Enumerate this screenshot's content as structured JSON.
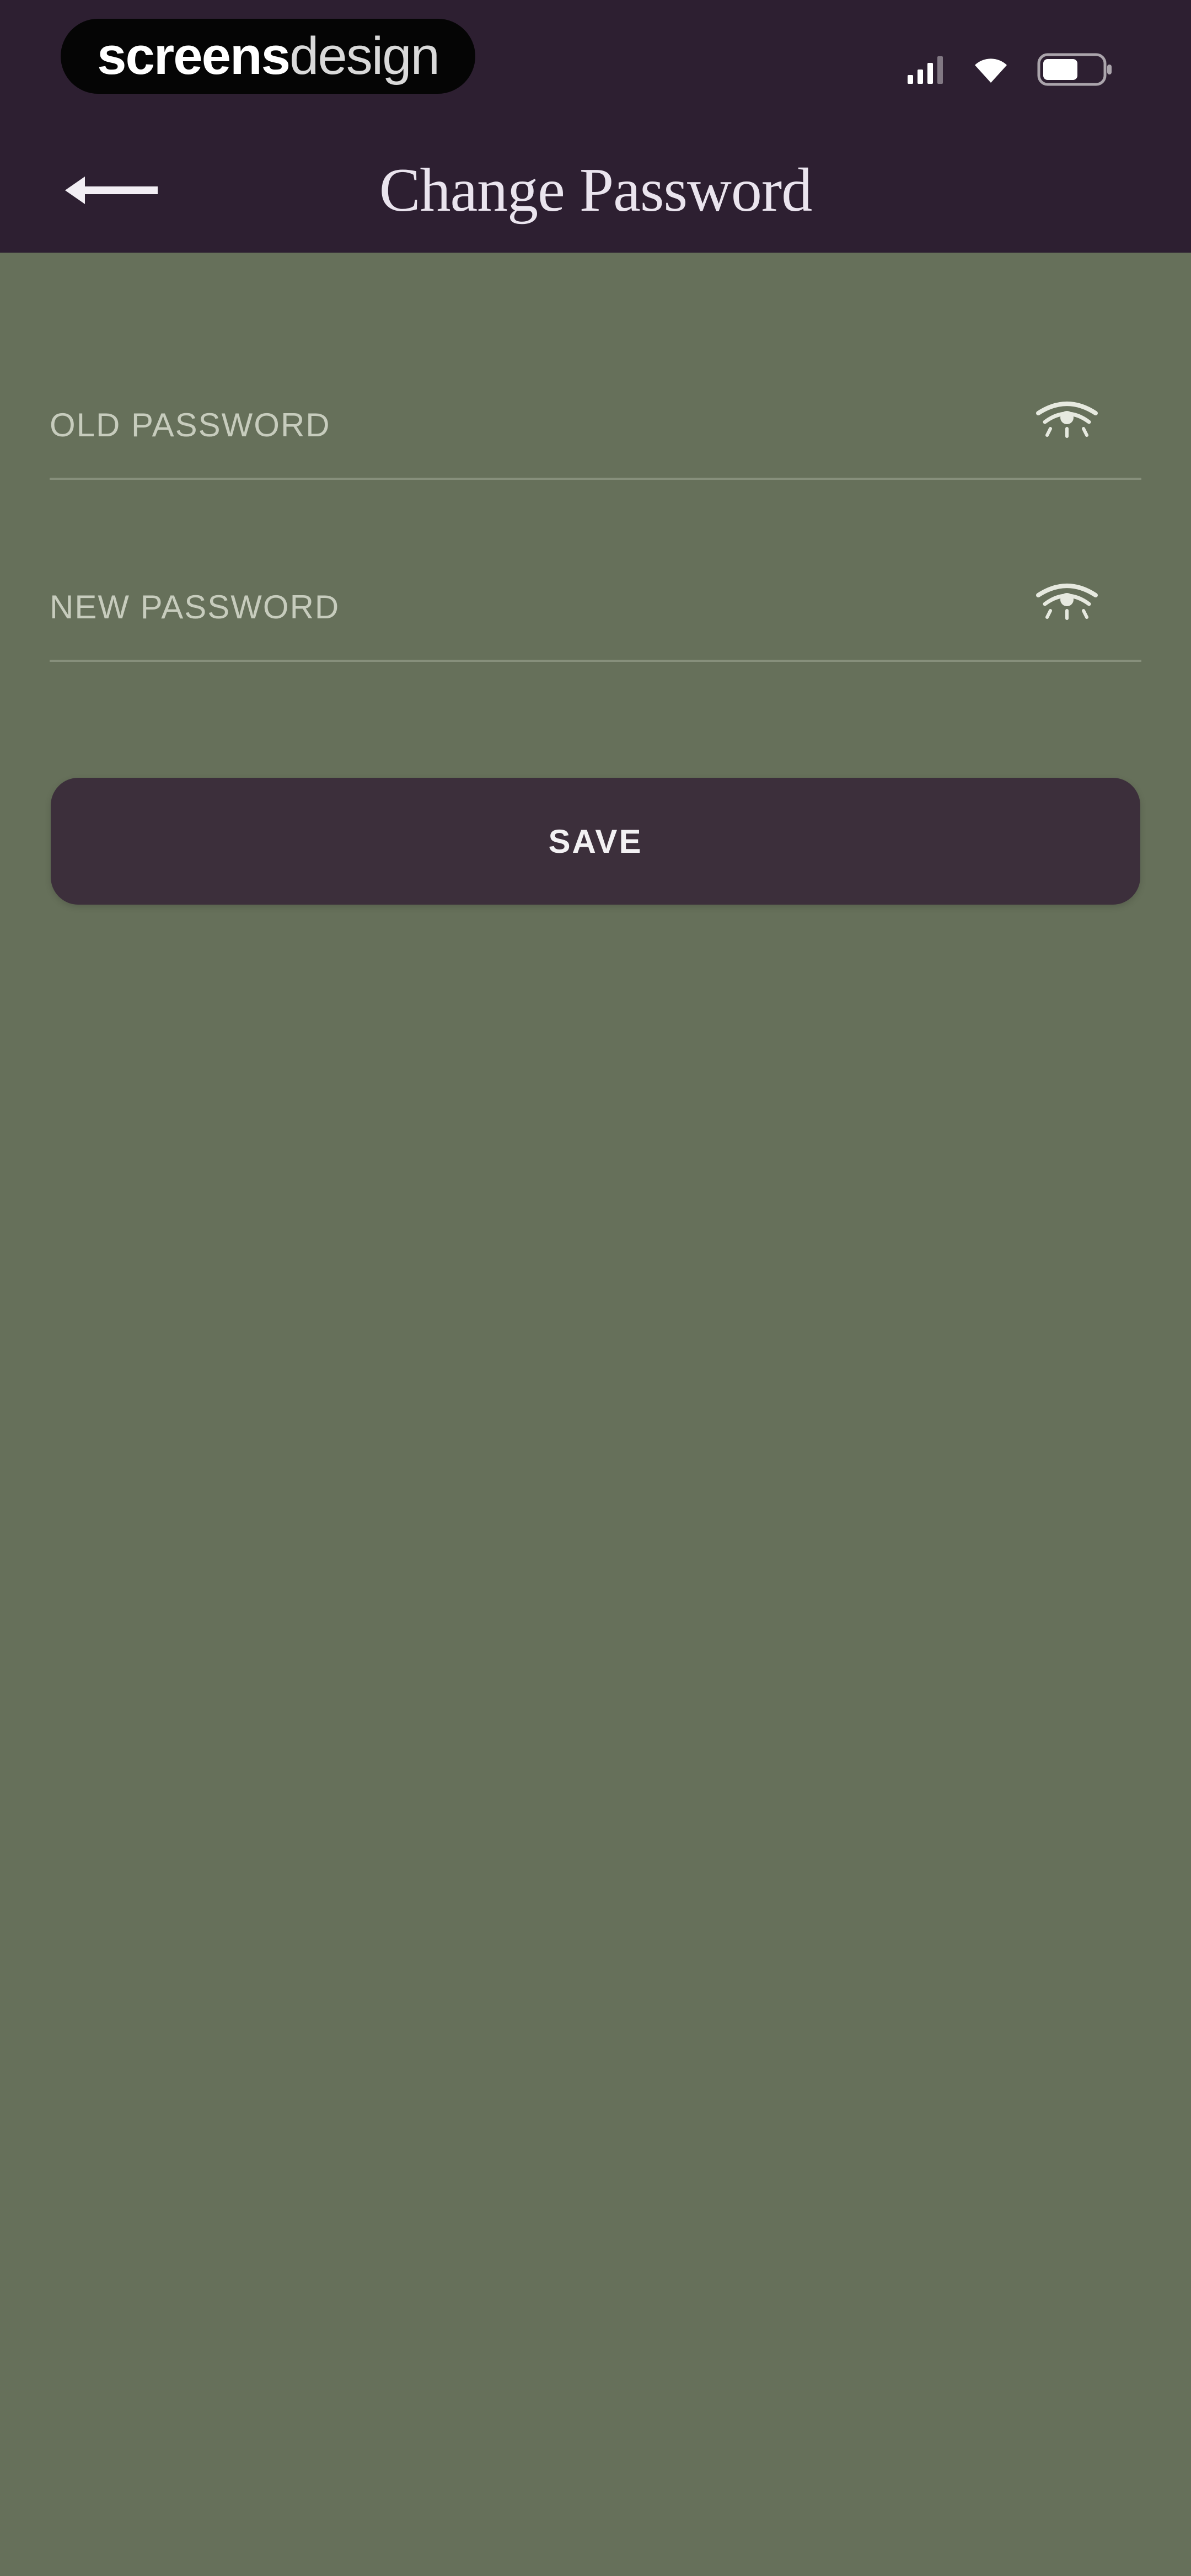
{
  "status_bar": {
    "badge_text_bold": "screens",
    "badge_text_light": "design",
    "signal_icon": "signal-icon",
    "wifi_icon": "wifi-icon",
    "battery_icon": "battery-icon"
  },
  "header": {
    "title": "Change Password",
    "back_icon": "arrow-left-icon"
  },
  "form": {
    "old_password": {
      "placeholder": "OLD PASSWORD",
      "value": "",
      "icon": "eye-icon"
    },
    "new_password": {
      "placeholder": "NEW PASSWORD",
      "value": "",
      "icon": "eye-icon"
    },
    "save_label": "SAVE"
  },
  "colors": {
    "header_bg": "#2d1f31",
    "body_bg": "#66705a",
    "button_bg": "#3c2f3b",
    "title_text": "#eae4ee"
  }
}
